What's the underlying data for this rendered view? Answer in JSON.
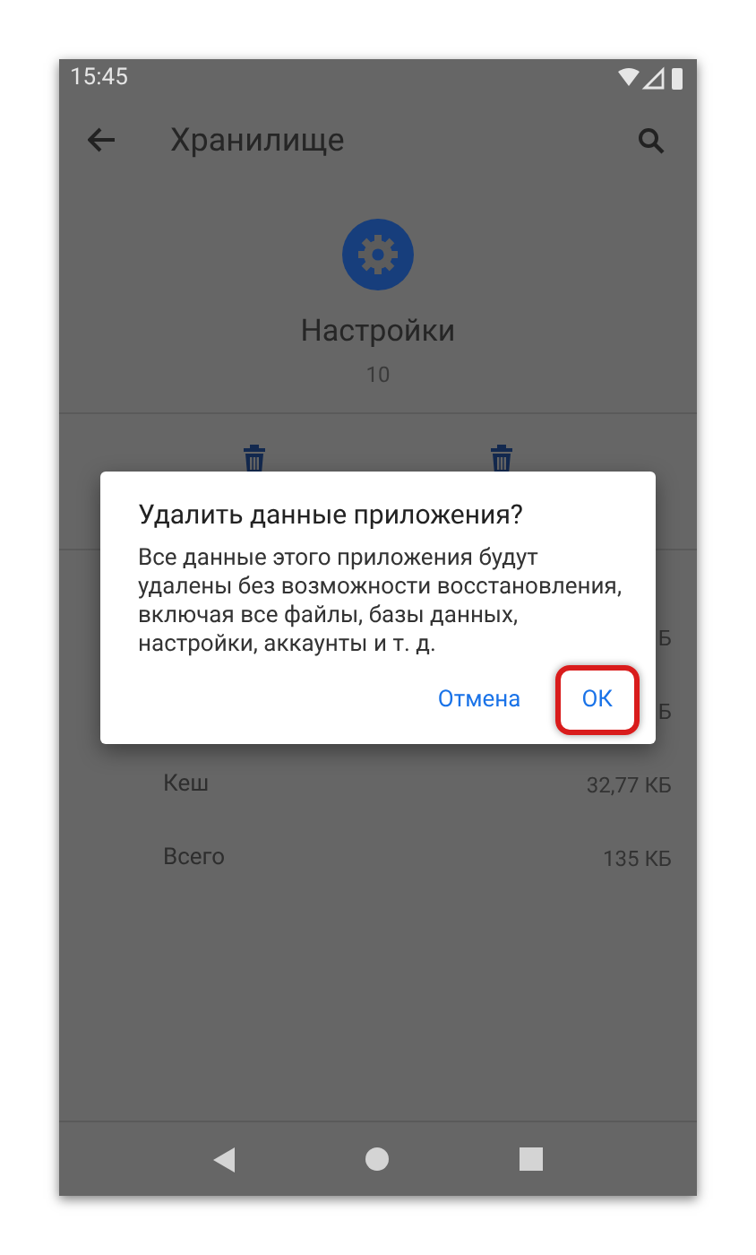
{
  "status_bar": {
    "time": "15:45"
  },
  "toolbar": {
    "title": "Хранилище"
  },
  "app": {
    "name": "Настройки",
    "version": "10"
  },
  "action_buttons": [
    {
      "kind": "trash"
    },
    {
      "kind": "trash"
    }
  ],
  "storage_rows": [
    {
      "label": "",
      "value": "Б"
    },
    {
      "label": "",
      "value": "Б"
    },
    {
      "label": "Кеш",
      "value": "32,77 КБ"
    },
    {
      "label": "Всего",
      "value": "135 КБ"
    }
  ],
  "dialog": {
    "title": "Удалить данные приложения?",
    "message": "Все данные этого приложения будут удалены без возможности восстановления, включая все файлы, базы данных, настройки, аккаунты и т. д.",
    "buttons": [
      {
        "label": "Отмена",
        "highlighted": false
      },
      {
        "label": "ОК",
        "highlighted": true
      }
    ]
  }
}
